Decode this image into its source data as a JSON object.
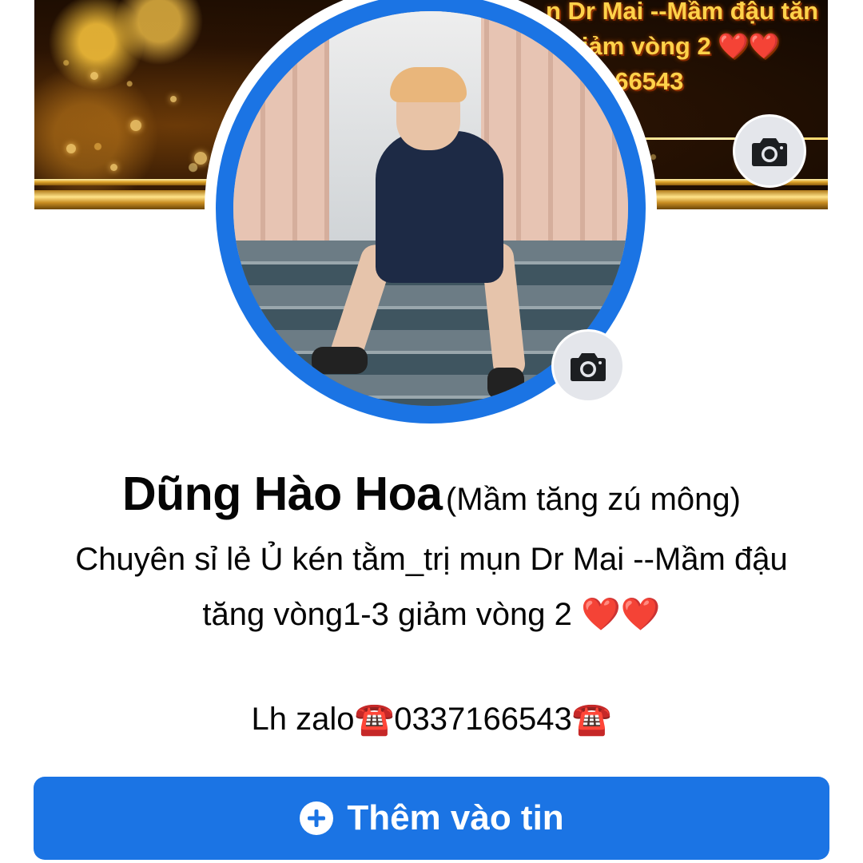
{
  "cover": {
    "overlay_text": "n Dr Mai --Mầm đậu tăn\n3 giảm vòng 2 ❤️❤️\n0337166543"
  },
  "profile": {
    "name": "Dũng Hào Hoa",
    "alternate_name": "(Mầm tăng zú mông)",
    "bio_line_1": "Chuyên sỉ lẻ Ủ kén tằm_trị mụn Dr Mai --Mầm đậu",
    "bio_line_2": "tăng vòng1-3 giảm vòng 2 ❤️❤️",
    "bio_line_3": "Lh zalo☎️0337166543☎️"
  },
  "actions": {
    "add_to_story_label": "Thêm vào tin"
  },
  "icons": {
    "cover_camera": "camera-icon",
    "avatar_camera": "camera-icon",
    "add_story": "plus-circle-icon"
  },
  "colors": {
    "accent": "#1b74e4",
    "icon_bg": "#e4e6eb",
    "text": "#050505"
  }
}
